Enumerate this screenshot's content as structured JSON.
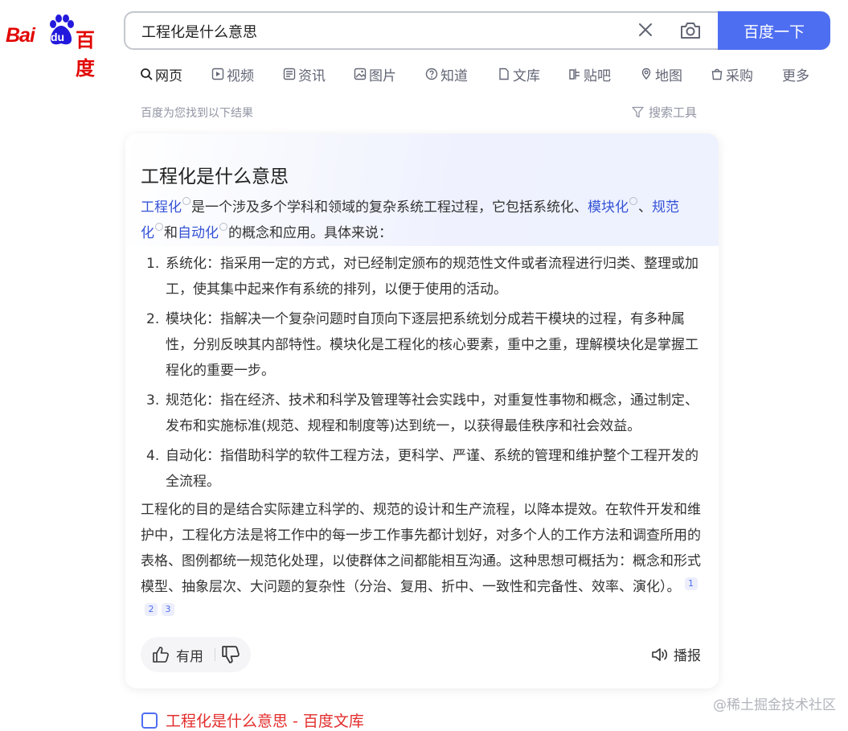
{
  "logo": {
    "latin": "Bai",
    "mark": "du",
    "chinese": "百度"
  },
  "search": {
    "query": "工程化是什么意思",
    "button_label": "百度一下"
  },
  "tabs": [
    {
      "label": "网页",
      "icon": "search-icon",
      "active": true
    },
    {
      "label": "视频",
      "icon": "video-icon"
    },
    {
      "label": "资讯",
      "icon": "news-icon"
    },
    {
      "label": "图片",
      "icon": "image-icon"
    },
    {
      "label": "知道",
      "icon": "question-icon"
    },
    {
      "label": "文库",
      "icon": "document-icon"
    },
    {
      "label": "贴吧",
      "icon": "tieba-icon"
    },
    {
      "label": "地图",
      "icon": "map-icon"
    },
    {
      "label": "采购",
      "icon": "shopping-icon"
    },
    {
      "label": "更多"
    }
  ],
  "results_info": "百度为您找到以下结果",
  "search_tools_label": "搜索工具",
  "answer": {
    "title": "工程化是什么意思",
    "intro": {
      "term1": "工程化",
      "text1": "是一个涉及多个学科和领域的复杂系统工程过程，它包括系统化、",
      "term2": "模块化",
      "text2": "、",
      "term3": "规范",
      "term3b": "化",
      "text3": "和",
      "term4": "自动化",
      "text4": "的概念和应用。具体来说："
    },
    "items": [
      {
        "num": "1.",
        "text": "系统化：指采用一定的方式，对已经制定颁布的规范性文件或者流程进行归类、整理或加工，使其集中起来作有系统的排列，以便于使用的活动。"
      },
      {
        "num": "2.",
        "text": "模块化：指解决一个复杂问题时自顶向下逐层把系统划分成若干模块的过程，有多种属性，分别反映其内部特性。模块化是工程化的核心要素，重中之重，理解模块化是掌握工程化的重要一步。"
      },
      {
        "num": "3.",
        "text": "规范化：指在经济、技术和科学及管理等社会实践中，对重复性事物和概念，通过制定、发布和实施标准(规范、规程和制度等)达到统一，以获得最佳秩序和社会效益。"
      },
      {
        "num": "4.",
        "text": "自动化：指借助科学的软件工程方法，更科学、严谨、系统的管理和维护整个工程开发的全流程。"
      }
    ],
    "conclusion": "工程化的目的是结合实际建立科学的、规范的设计和生产流程，以降本提效。在软件开发和维护中，工程化方法是将工作中的每一步工作事先都计划好，对多个人的工作方法和调查所用的表格、图例都统一规范化处理，以使群体之间都能相互沟通。这种思想可概括为：概念和形式模型、抽象层次、大问题的复杂性（分治、复用、折中、一致性和完备性、效率、演化）。",
    "citations": [
      "1",
      "2",
      "3"
    ],
    "like_label": "有用",
    "speak_label": "播报"
  },
  "next_result_title": "工程化是什么意思 - 百度文库",
  "watermark": "@稀土掘金技术社区",
  "colors": {
    "brand_blue": "#4e6ef2",
    "baidu_red": "#e10602",
    "link": "#3553d6"
  }
}
